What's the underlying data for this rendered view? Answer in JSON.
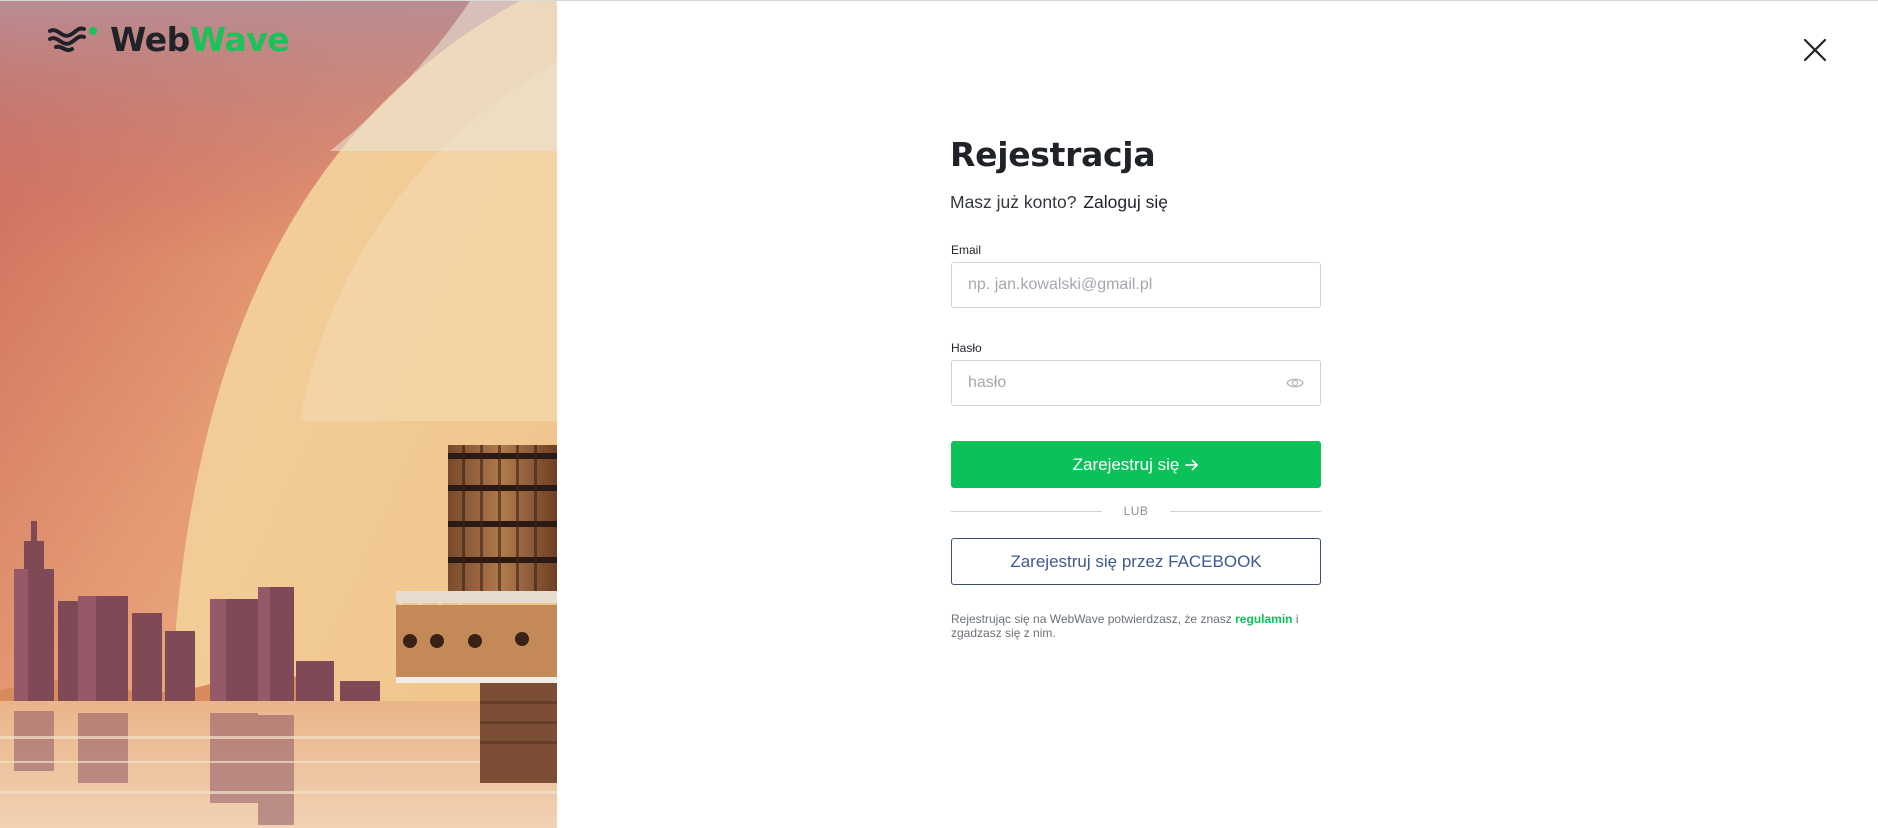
{
  "brand": {
    "name_part1": "Web",
    "name_part2": "Wave",
    "accent_color": "#0bc25a"
  },
  "form": {
    "title": "Rejestracja",
    "have_account_text": "Masz już konto?",
    "login_link": "Zaloguj się",
    "email": {
      "label": "Email",
      "placeholder": "np. jan.kowalski@gmail.pl",
      "value": ""
    },
    "password": {
      "label": "Hasło",
      "placeholder": "hasło",
      "value": ""
    },
    "submit_label": "Zarejestruj się",
    "submit_icon": "arrow-right-icon",
    "or_label": "LUB",
    "facebook_label": "Zarejestruj się przez FACEBOOK",
    "terms_prefix": "Rejestrując się na WebWave potwierdzasz, że znasz",
    "terms_link": "regulamin",
    "terms_suffix": "i zgadzasz się z nim."
  },
  "icons": {
    "close": "close-icon",
    "password_toggle": "eye-icon",
    "logo": "webwave-logo-icon"
  },
  "colors": {
    "primary_button": "#0bc25a",
    "facebook_text": "#3d5a8f",
    "art_red": "#d0584a",
    "art_sand": "#f1cc97"
  }
}
